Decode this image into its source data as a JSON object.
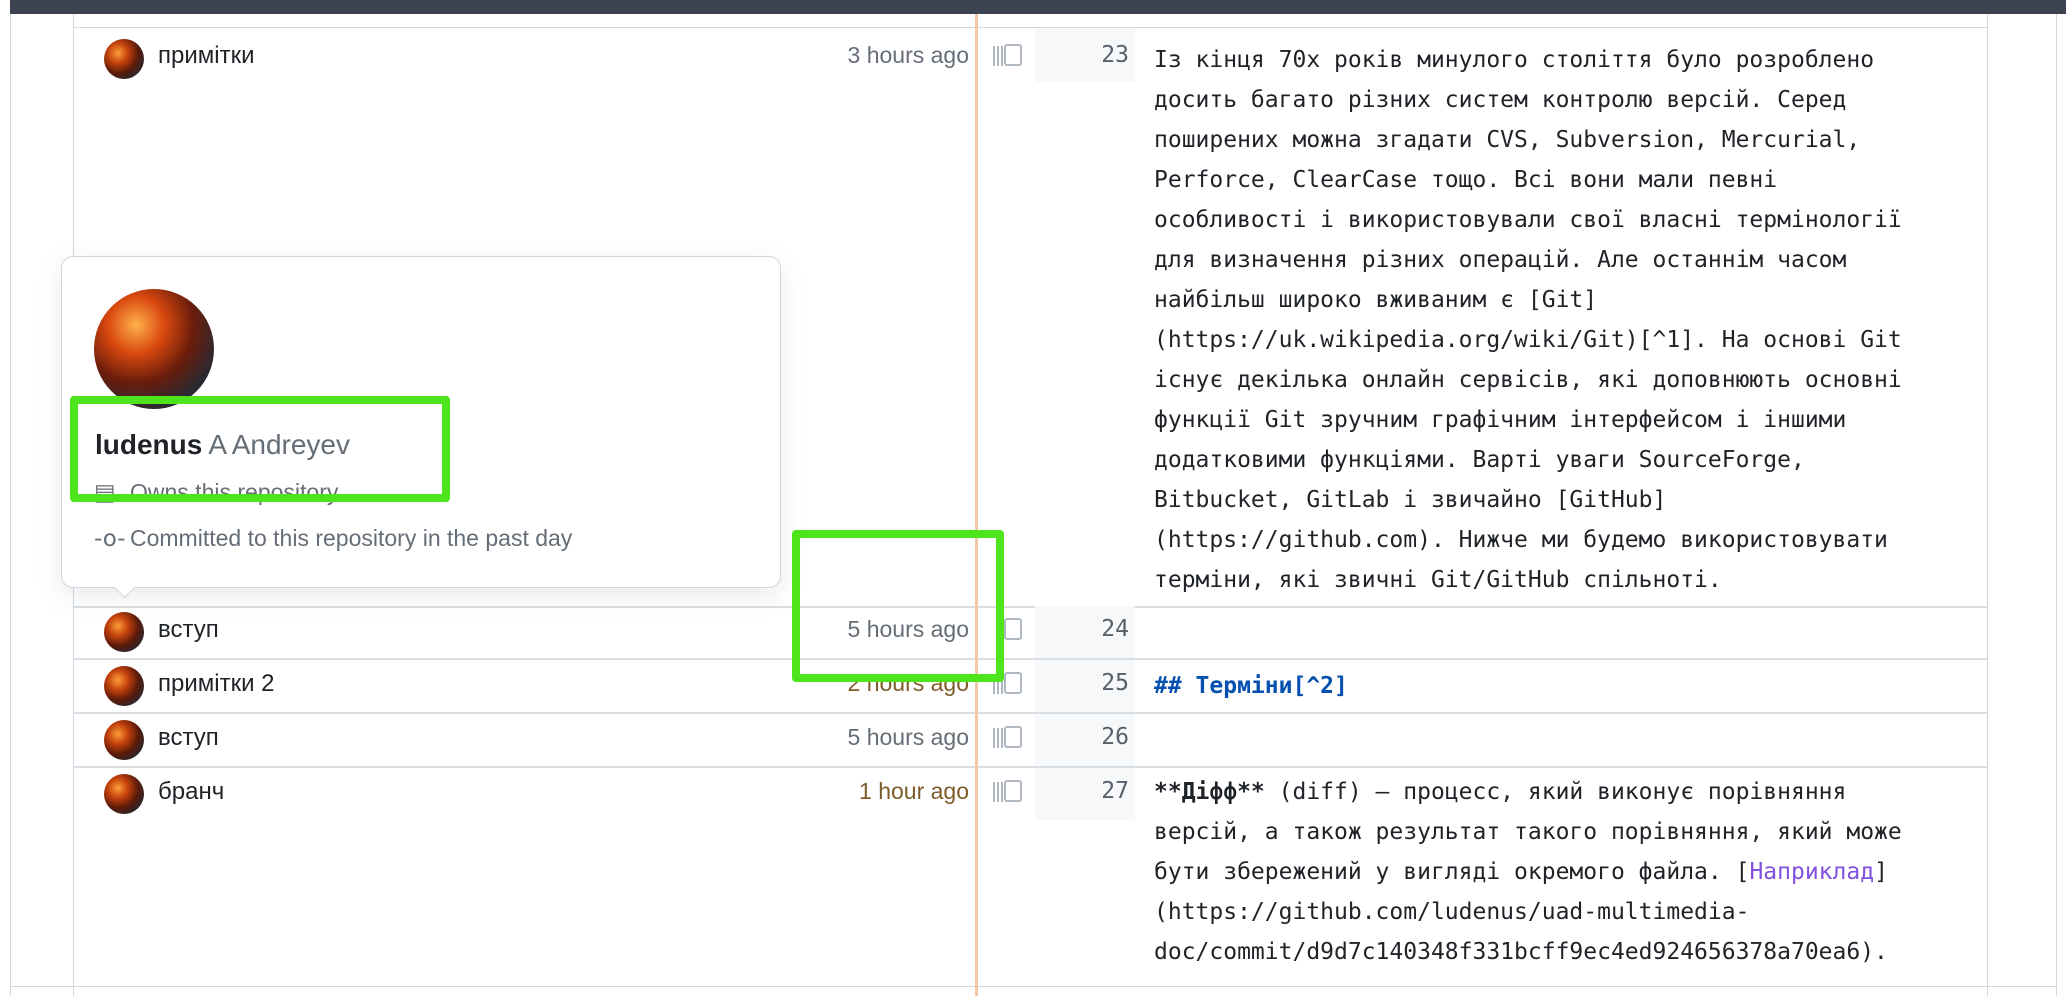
{
  "rows": [
    {
      "message": "примітки",
      "time": "3 hours ago",
      "line_number": "23",
      "code_lines": [
        "Із кінця 70х років минулого століття було розроблено",
        "досить багато різних систем контролю версій. Серед",
        "поширених можна згадати CVS, Subversion, Mercurial,",
        "Perforce, ClearCase тощо. Всі вони мали певні",
        "особливості і використовували свої власні термінології",
        "для визначення різних операцій. Але останнім часом",
        "найбільш широко вживаним є [Git]",
        "(https://uk.wikipedia.org/wiki/Git)[^1]. На основі Git",
        "існує декілька онлайн сервісів, які доповнюють основні",
        "функції Git зручним графічним інтерфейсом і іншими",
        "додатковими функціями. Варті уваги SourceForge,",
        "Bitbucket, GitLab і звичайно [GitHub]",
        "(https://github.com). Нижче ми будемо використовувати",
        "терміни, які звичні Git/GitHub спільноті."
      ]
    },
    {
      "message": "вступ",
      "time": "5 hours ago",
      "line_number": "24"
    },
    {
      "message": "примітки 2",
      "time": "2 hours ago",
      "line_number": "25",
      "heading": "## Терміни[^2]"
    },
    {
      "message": "вступ",
      "time": "5 hours ago",
      "line_number": "26"
    },
    {
      "message": "бранч",
      "time": "1 hour ago",
      "line_number": "27",
      "bold_term": "**Діфф**",
      "line1_rest": " (diff) – процесс, який виконує порівняння",
      "line2": "версій, а також результат такого порівняння, який може",
      "line3_pre": "бути збережений у вигляді окремого файла. [",
      "link_text": "Наприклад",
      "line3_post": "]",
      "line4": "(https://github.com/ludenus/uad-multimedia-",
      "line5": "doc/commit/d9d7c140348f331bcff9ec4ed924656378a70ea6)."
    }
  ],
  "popover": {
    "login": "ludenus",
    "full_name": "A Andreyev",
    "owns": "Owns this repository",
    "committed": "Committed to this repository in the past day",
    "owns_icon": "repo-icon",
    "commit_icon": "git-commit-icon"
  },
  "colors": {
    "highlight": "#4de41b",
    "heading": "#0550ae",
    "link": "#8250df",
    "blame_bar": "#f4c7a6"
  }
}
